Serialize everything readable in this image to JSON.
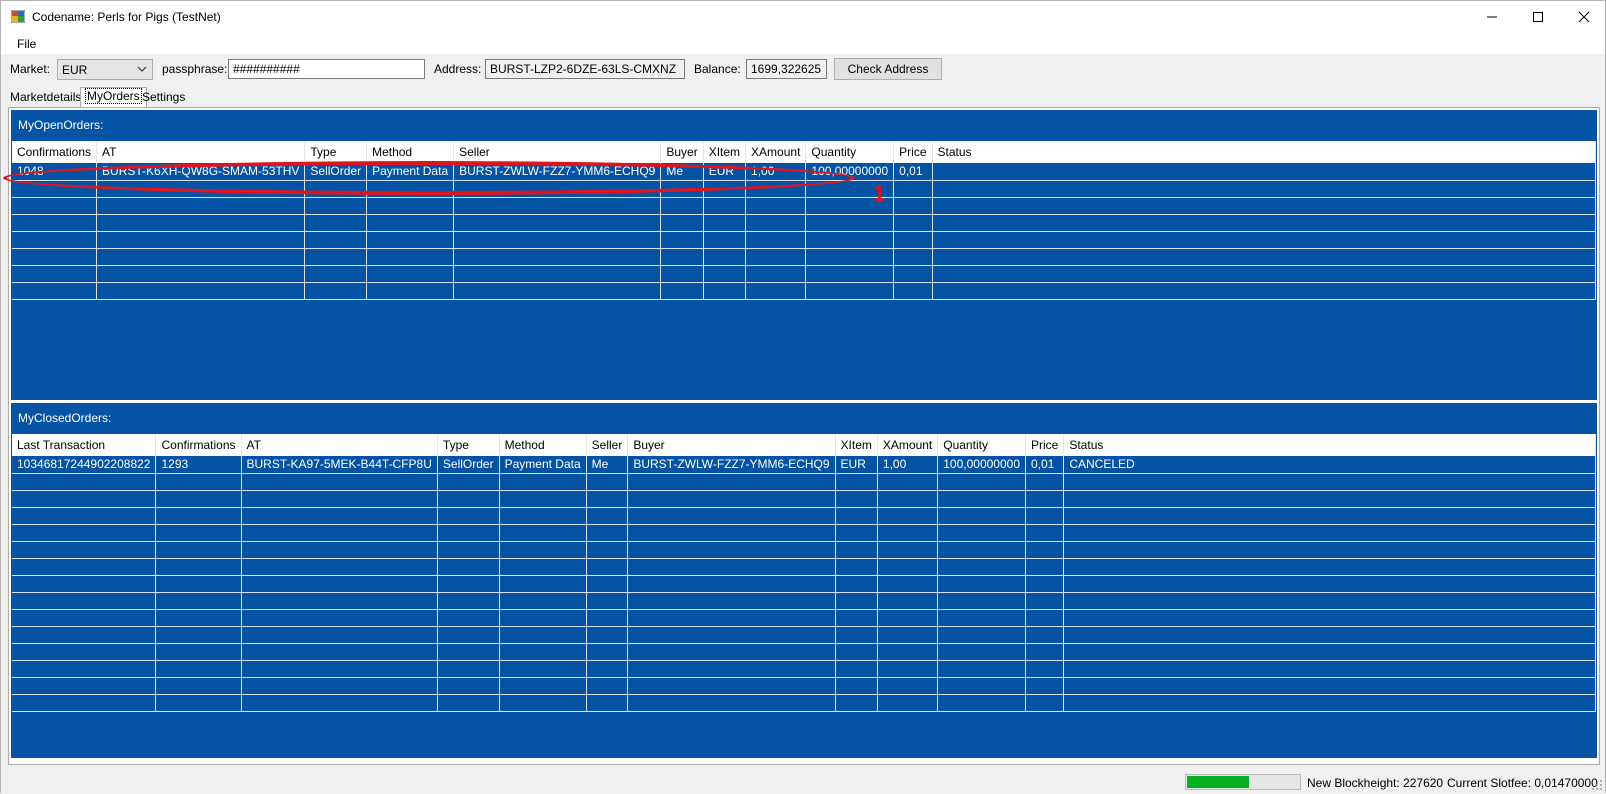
{
  "window": {
    "title": "Codename: Perls for Pigs (TestNet)"
  },
  "menu": {
    "file": "File"
  },
  "toolbar": {
    "market_label": "Market:",
    "market_value": "EUR",
    "passphrase_label": "passphrase:",
    "passphrase_value": "##########",
    "address_label": "Address:",
    "address_value": "BURST-LZP2-6DZE-63LS-CMXNZ",
    "balance_label": "Balance:",
    "balance_value": "1699,322625",
    "check_button": "Check Address"
  },
  "tabs": [
    {
      "label": "Marketdetails"
    },
    {
      "label": "MyOrders",
      "active": true
    },
    {
      "label": "Settings"
    }
  ],
  "open_orders": {
    "title": "MyOpenOrders:",
    "columns": [
      "Confirmations",
      "AT",
      "Type",
      "Method",
      "Seller",
      "Buyer",
      "XItem",
      "XAmount",
      "Quantity",
      "Price",
      "Status"
    ],
    "rows": [
      [
        "1048",
        "BURST-K6XH-QW8G-SMAM-53THV",
        "SellOrder",
        "Payment Data",
        "BURST-ZWLW-FZZ7-YMM6-ECHQ9",
        "Me",
        "EUR",
        "1,00",
        "100,00000000",
        "0,01",
        ""
      ]
    ]
  },
  "closed_orders": {
    "title": "MyClosedOrders:",
    "columns": [
      "Last Transaction",
      "Confirmations",
      "AT",
      "Type",
      "Method",
      "Seller",
      "Buyer",
      "XItem",
      "XAmount",
      "Quantity",
      "Price",
      "Status"
    ],
    "rows": [
      [
        "10346817244902208822",
        "1293",
        "BURST-KA97-5MEK-B44T-CFP8U",
        "SellOrder",
        "Payment Data",
        "Me",
        "BURST-ZWLW-FZZ7-YMM6-ECHQ9",
        "EUR",
        "1,00",
        "100,00000000",
        "0,01",
        "CANCELED"
      ]
    ]
  },
  "annotation": {
    "number": "1"
  },
  "status": {
    "progress_fraction": 0.55,
    "blockheight": "New Blockheight: 227620",
    "slotfee": "Current Slotfee: 0,01470000"
  },
  "colors": {
    "grid_bg": "#0553a4",
    "progress": "#06b025",
    "annotation": "#e0141e"
  }
}
